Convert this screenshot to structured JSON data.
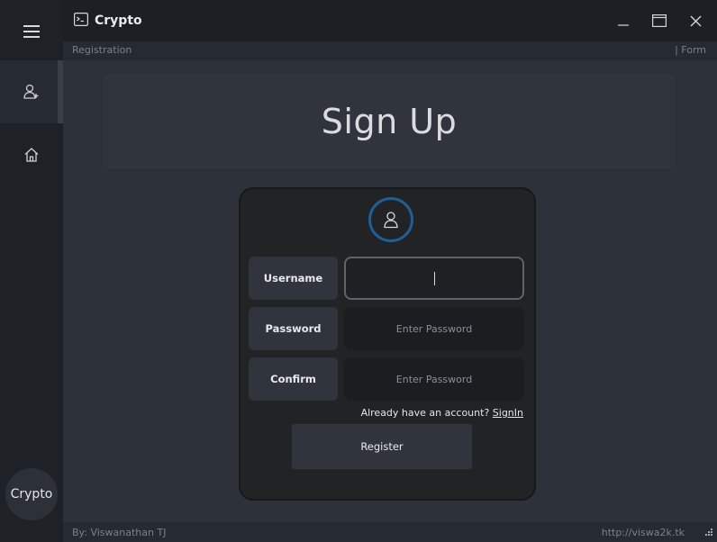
{
  "window": {
    "title": "Crypto",
    "controls": [
      "minimize-icon",
      "maximize-icon",
      "close-icon"
    ]
  },
  "sidebar": {
    "items": [
      {
        "icon": "hamburger-menu-icon"
      },
      {
        "icon": "add-user-icon",
        "active": true
      },
      {
        "icon": "home-icon"
      }
    ],
    "badge": "Crypto"
  },
  "subbar": {
    "left": "Registration",
    "right": "| Form"
  },
  "banner": {
    "title": "Sign Up"
  },
  "form": {
    "avatar_icon": "user-icon",
    "accent_color": "#1e5f96",
    "username_label": "Username",
    "username_value": "",
    "password_label": "Password",
    "password_placeholder": "Enter Password",
    "confirm_label": "Confirm",
    "confirm_placeholder": "Enter Password",
    "signin_prompt": "Already have an account?",
    "signin_link": "SignIn",
    "register_label": "Register"
  },
  "footer": {
    "author": "By: Viswanathan TJ",
    "url": "http://viswa2k.tk"
  }
}
